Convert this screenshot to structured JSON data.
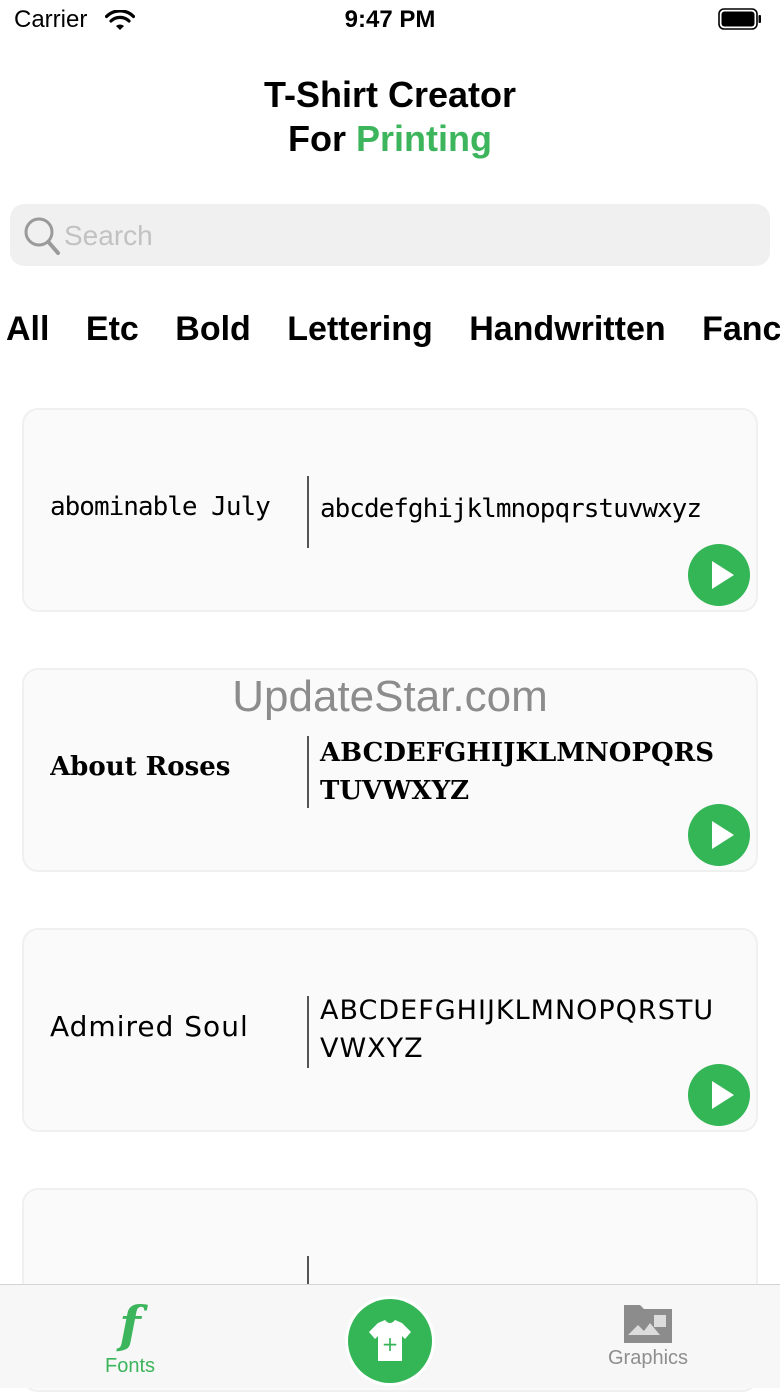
{
  "status_bar": {
    "carrier": "Carrier",
    "time": "9:47 PM"
  },
  "header": {
    "title_line1": "T-Shirt Creator",
    "title_prefix": "For",
    "title_accent": "Printing"
  },
  "search": {
    "placeholder": "Search",
    "value": ""
  },
  "categories": [
    "All",
    "Etc",
    "Bold",
    "Lettering",
    "Handwritten",
    "Fanc"
  ],
  "fonts": [
    {
      "name": "abominable July",
      "sample": "abcdefghijklmnopqrstuvwxyz"
    },
    {
      "name": "About Roses",
      "sample": "ABCDEFGHIJKLMNOPQRSTUVWXYZ"
    },
    {
      "name": "Admired Soul",
      "sample": "ABCDEFGHIJKLMNOPQRSTUVWXYZ"
    },
    {
      "name": "",
      "sample": ""
    }
  ],
  "watermark": "UpdateStar.com",
  "tabbar": {
    "fonts_icon": "f",
    "fonts_label": "Fonts",
    "create_icon": "+",
    "graphics_label": "Graphics"
  },
  "colors": {
    "accent": "#3cb55c",
    "play": "#34b556"
  }
}
